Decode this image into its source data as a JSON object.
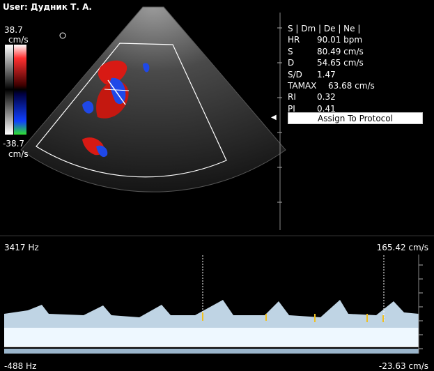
{
  "header": {
    "user": "User: Дудник Т. А."
  },
  "color_scale": {
    "top_value": "38.7",
    "top_unit": "cm/s",
    "bottom_value": "-38.7",
    "bottom_unit": "cm/s"
  },
  "measurements": {
    "tabs": "S | Dm | De | Ne |",
    "rows": [
      {
        "label": "HR",
        "value": "90.01 bpm"
      },
      {
        "label": "S",
        "value": "80.49 cm/s"
      },
      {
        "label": "D",
        "value": "54.65 cm/s"
      },
      {
        "label": "S/D",
        "value": "1.47"
      },
      {
        "label": "TAMAX",
        "value": "63.68 cm/s"
      },
      {
        "label": "RI",
        "value": "0.32"
      },
      {
        "label": "PI",
        "value": "0.41"
      }
    ],
    "assign_button": "Assign To Protocol"
  },
  "spectrum": {
    "freq_top": "3417 Hz",
    "velocity_top": "165.42 cm/s",
    "freq_bottom": "-488 Hz",
    "velocity_bottom": "-23.63 cm/s"
  },
  "colors": {
    "red": "#e0201a",
    "blue": "#1840e0",
    "spectrum": "#d8eeff"
  }
}
